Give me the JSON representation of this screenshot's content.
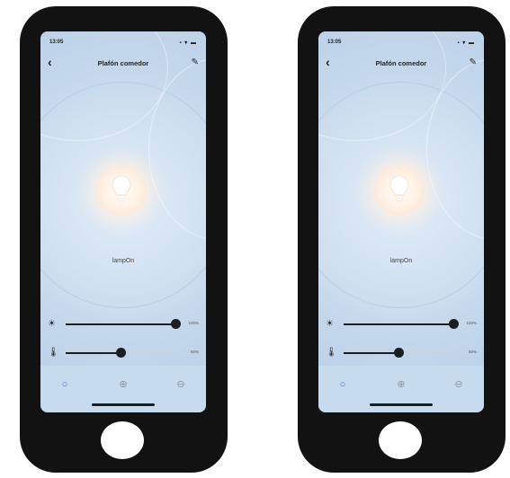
{
  "phones": [
    {
      "status_time": "13:05",
      "status_icons": "▪ ▾ ▬",
      "back": "‹",
      "title": "Plafón comedor",
      "edit": "✎",
      "lamp_label": "lampOn",
      "brightness": {
        "icon": "☀",
        "value": 100,
        "value_label": "100%"
      },
      "temperature": {
        "icon": "🌡",
        "value": 50,
        "value_label": "50%"
      },
      "tabs": [
        {
          "icon": "○",
          "name": "power-icon"
        },
        {
          "icon": "⊕",
          "name": "add-icon"
        },
        {
          "icon": "⊖",
          "name": "remove-icon"
        }
      ]
    },
    {
      "status_time": "13:05",
      "status_icons": "▪ ▾ ▬",
      "back": "‹",
      "title": "Plafón comedor",
      "edit": "✎",
      "lamp_label": "lampOn",
      "brightness": {
        "icon": "☀",
        "value": 100,
        "value_label": "100%"
      },
      "temperature": {
        "icon": "🌡",
        "value": 50,
        "value_label": "50%"
      },
      "tabs": [
        {
          "icon": "○",
          "name": "power-icon"
        },
        {
          "icon": "⊕",
          "name": "add-icon"
        },
        {
          "icon": "⊖",
          "name": "remove-icon"
        }
      ]
    }
  ],
  "colors": {
    "phone_body": "#121212",
    "screen_bg": "#cfe0f0",
    "accent": "#2f6fd6",
    "lamp_glow": "#fff3e6"
  }
}
